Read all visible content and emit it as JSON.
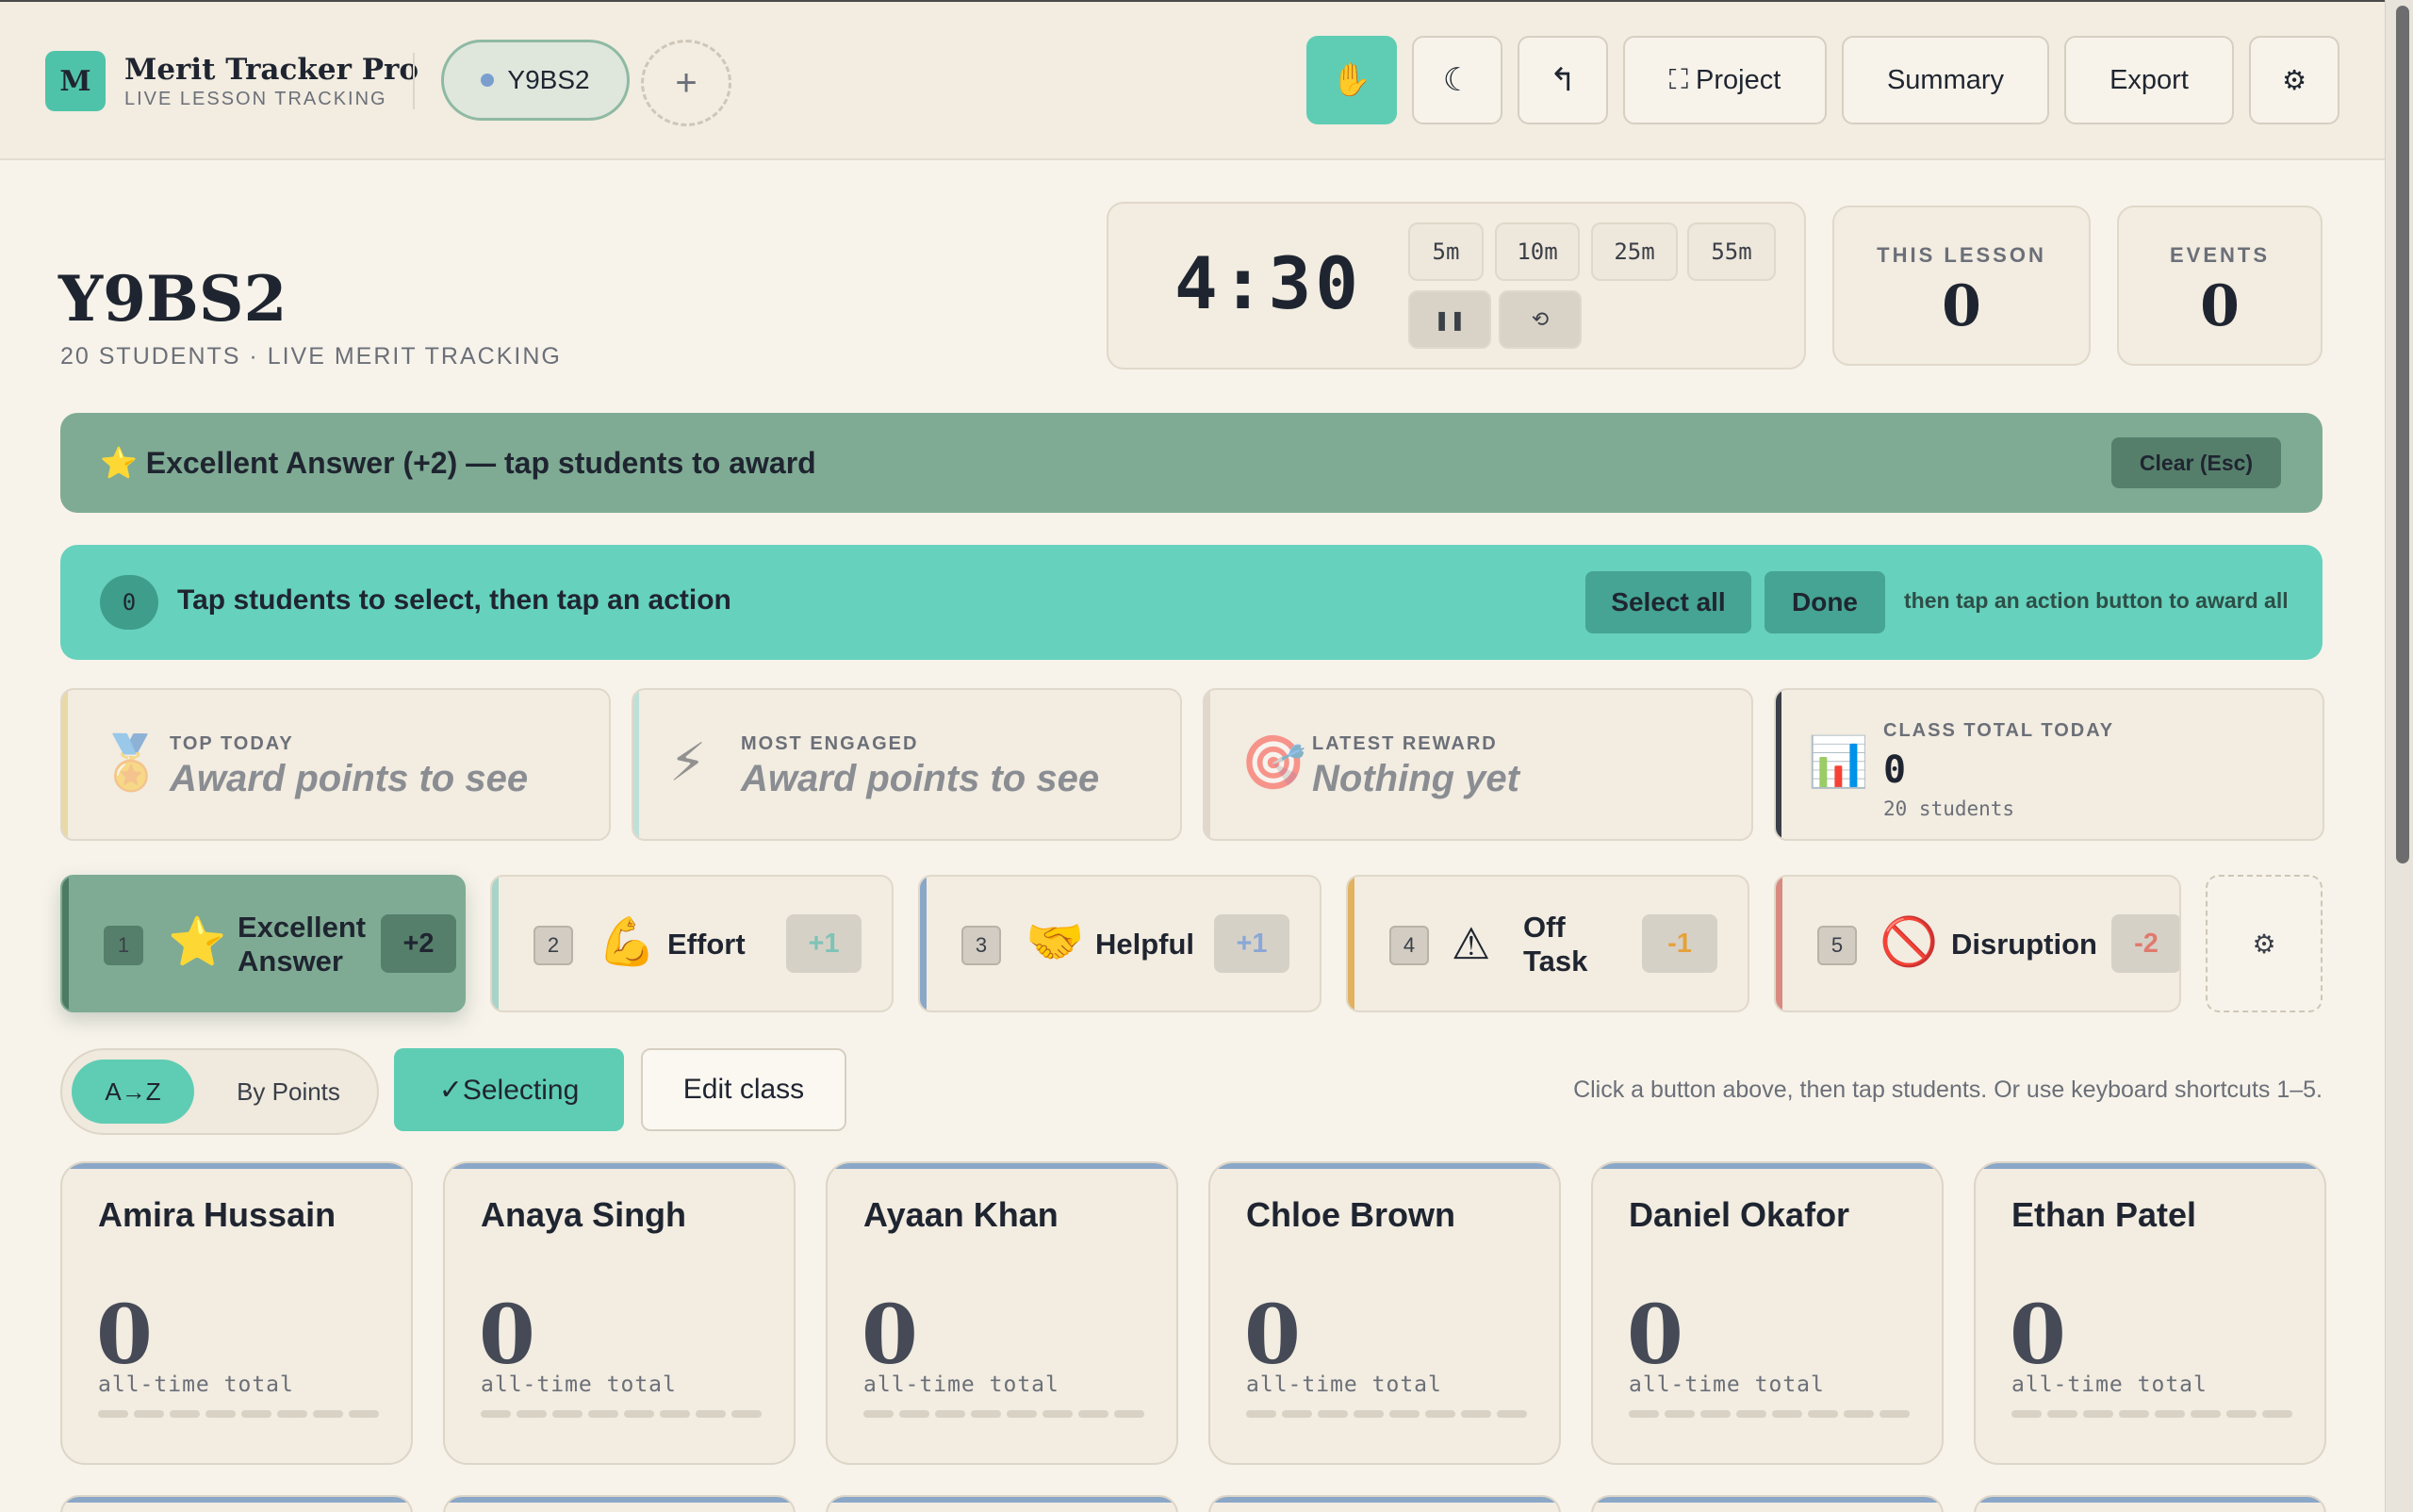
{
  "header": {
    "logo_letter": "M",
    "app_title": "Merit Tracker Pro",
    "app_subtitle": "LIVE LESSON TRACKING",
    "class_pill": "Y9BS2",
    "add_class": "+",
    "buttons": {
      "hand": "✋",
      "moon": "☾",
      "undo": "↰",
      "project": "⛶ Project",
      "summary": "Summary",
      "export": "Export",
      "settings": "⚙"
    }
  },
  "page": {
    "title": "Y9BS2",
    "subtitle": "20 STUDENTS · LIVE MERIT TRACKING"
  },
  "timer": {
    "value": "4:30",
    "presets": [
      "5m",
      "10m",
      "25m",
      "55m"
    ],
    "pause": "❚❚",
    "reset": "⟲"
  },
  "stats": {
    "this_lesson_label": "THIS LESSON",
    "this_lesson_value": "0",
    "events_label": "EVENTS",
    "events_value": "0"
  },
  "award_banner": {
    "text": "⭐ Excellent Answer (+2) — tap students to award",
    "clear": "Clear (Esc)"
  },
  "select_banner": {
    "count": "0",
    "text": "Tap students to select, then tap an action",
    "select_all": "Select all",
    "done": "Done",
    "hint": "then tap an action button to award all"
  },
  "summary_cards": [
    {
      "icon": "🏅",
      "label": "TOP TODAY",
      "value": "Award points to see",
      "edge": "#e8d9a6"
    },
    {
      "icon": "⚡",
      "label": "MOST ENGAGED",
      "value": "Award points to see",
      "edge": "#bfe0d6"
    },
    {
      "icon": "🎯",
      "label": "LATEST REWARD",
      "value": "Nothing yet",
      "edge": "#e0d8ca"
    },
    {
      "icon": "📊",
      "label": "CLASS TOTAL TODAY",
      "value": "0",
      "sub": "20 students",
      "edge": "#3a3f48"
    }
  ],
  "actions": [
    {
      "key": "1",
      "icon": "⭐",
      "label": "Excellent Answer",
      "points": "+2",
      "points_color": "#1f2530",
      "edge": "#4d7a64"
    },
    {
      "key": "2",
      "icon": "💪",
      "label": "Effort",
      "points": "+1",
      "points_color": "#7fc3b6",
      "edge": "#a9d3c8"
    },
    {
      "key": "3",
      "icon": "🤝",
      "label": "Helpful",
      "points": "+1",
      "points_color": "#8aa7d6",
      "edge": "#8aa7c7"
    },
    {
      "key": "4",
      "icon": "⚠",
      "label": "Off Task",
      "points": "-1",
      "points_color": "#e5a23a",
      "edge": "#e2b25f"
    },
    {
      "key": "5",
      "icon": "🚫",
      "label": "Disruption",
      "points": "-2",
      "points_color": "#e07a6e",
      "edge": "#d98a80"
    }
  ],
  "actions_settings": "⚙",
  "toolbar": {
    "sort_az": "A→Z",
    "sort_points": "By Points",
    "selecting": "✓Selecting",
    "edit_class": "Edit class",
    "hint": "Click a button above, then tap students. Or use keyboard shortcuts 1–5."
  },
  "students": [
    {
      "name": "Amira Hussain",
      "points": "0",
      "caption": "all-time total"
    },
    {
      "name": "Anaya Singh",
      "points": "0",
      "caption": "all-time total"
    },
    {
      "name": "Ayaan Khan",
      "points": "0",
      "caption": "all-time total"
    },
    {
      "name": "Chloe Brown",
      "points": "0",
      "caption": "all-time total"
    },
    {
      "name": "Daniel Okafor",
      "points": "0",
      "caption": "all-time total"
    },
    {
      "name": "Ethan Patel",
      "points": "0",
      "caption": "all-time total"
    }
  ]
}
